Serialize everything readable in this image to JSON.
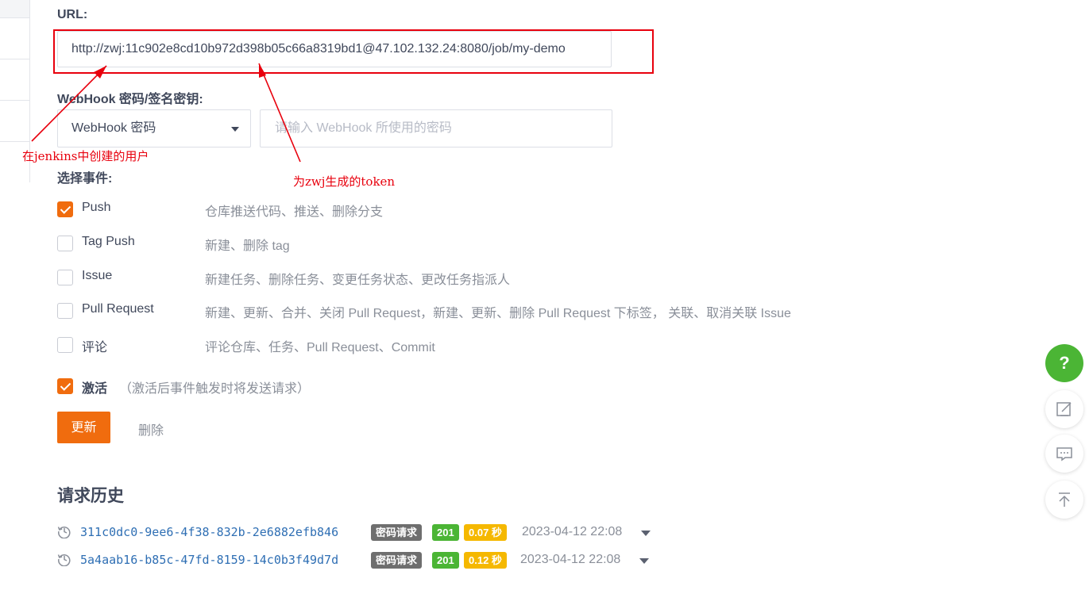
{
  "url_section": {
    "label": "URL:",
    "value": "http://zwj:11c902e8cd10b972d398b05c66a8319bd1@47.102.132.24:8080/job/my-demo"
  },
  "webhook_section": {
    "label": "WebHook 密码/签名密钥:",
    "selected_type": "WebHook 密码",
    "password_placeholder": "请输入 WebHook 所使用的密码"
  },
  "annotations": {
    "user_note": "在jenkins中创建的用户",
    "token_note": "为zwj生成的token",
    "color": "#e8000d"
  },
  "events": {
    "label": "选择事件:",
    "items": [
      {
        "name": "Push",
        "desc": "仓库推送代码、推送、删除分支",
        "checked": true
      },
      {
        "name": "Tag Push",
        "desc": "新建、删除 tag",
        "checked": false
      },
      {
        "name": "Issue",
        "desc": "新建任务、删除任务、变更任务状态、更改任务指派人",
        "checked": false
      },
      {
        "name": "Pull Request",
        "desc": "新建、更新、合并、关闭 Pull Request，新建、更新、删除 Pull Request 下标签， 关联、取消关联 Issue",
        "checked": false
      },
      {
        "name": "评论",
        "desc": "评论仓库、任务、Pull Request、Commit",
        "checked": false
      }
    ]
  },
  "activate": {
    "label": "激活",
    "hint": "（激活后事件触发时将发送请求）",
    "checked": true
  },
  "actions": {
    "update_label": "更新",
    "delete_label": "删除"
  },
  "history": {
    "title": "请求历史",
    "rows": [
      {
        "id": "311c0dc0-9ee6-4f38-832b-2e6882efb846",
        "type": "密码请求",
        "status": "201",
        "duration": "0.07 秒",
        "time": "2023-04-12 22:08"
      },
      {
        "id": "5a4aab16-b85c-47fd-8159-14c0b3f49d7d",
        "type": "密码请求",
        "status": "201",
        "duration": "0.12 秒",
        "time": "2023-04-12 22:08"
      }
    ]
  },
  "float_buttons": [
    {
      "icon": "help-icon",
      "glyph": "?"
    },
    {
      "icon": "edit-icon"
    },
    {
      "icon": "comment-icon"
    },
    {
      "icon": "back-to-top-icon"
    }
  ],
  "colors": {
    "accent": "#f06c0e",
    "success": "#4bb535",
    "warning": "#f5b800",
    "link": "#2f6fb4"
  }
}
